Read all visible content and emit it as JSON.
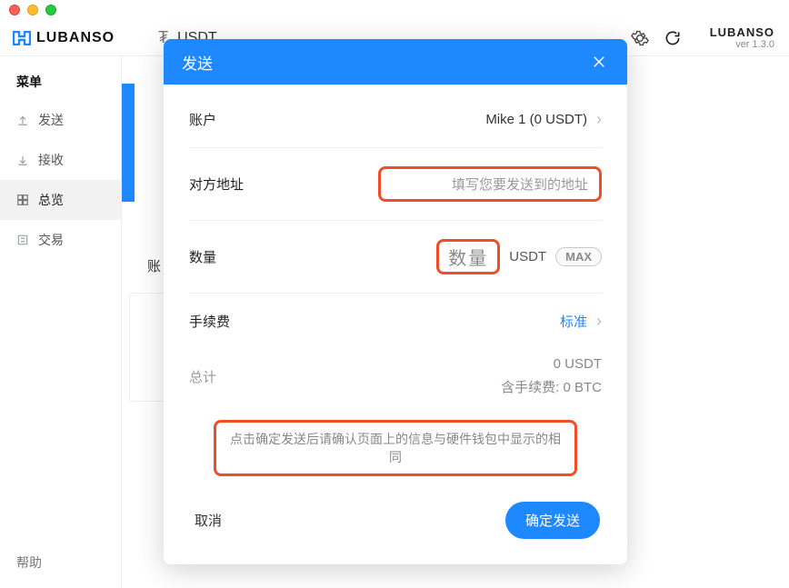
{
  "brand": {
    "name": "LUBANSO",
    "name_right": "LUBANSO",
    "version": "ver 1.3.0"
  },
  "topbar": {
    "coin_symbol": "₮",
    "coin_name": "USDT"
  },
  "sidebar": {
    "menu_title": "菜单",
    "items": [
      {
        "label": "发送"
      },
      {
        "label": "接收"
      },
      {
        "label": "总览"
      },
      {
        "label": "交易"
      }
    ],
    "help": "帮助"
  },
  "main": {
    "section_head": "账"
  },
  "modal": {
    "title": "发送",
    "account_label": "账户",
    "account_value": "Mike 1 (0 USDT)",
    "address_label": "对方地址",
    "address_placeholder": "填写您要发送到的地址",
    "qty_label": "数量",
    "qty_placeholder": "数量",
    "qty_unit": "USDT",
    "max": "MAX",
    "fee_label": "手续费",
    "fee_value": "标准",
    "total_label": "总计",
    "total_value": "0 USDT",
    "fee_included": "含手续费: 0 BTC",
    "notice": "点击确定发送后请确认页面上的信息与硬件钱包中显示的相同",
    "cancel": "取消",
    "confirm": "确定发送"
  }
}
